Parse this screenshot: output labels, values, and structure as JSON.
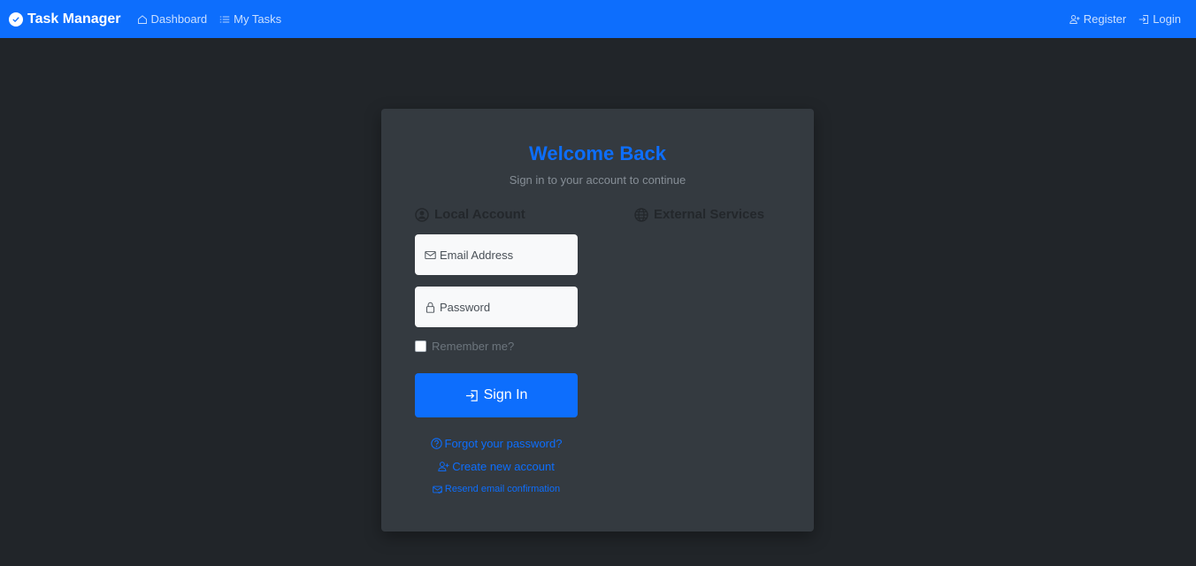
{
  "navbar": {
    "brand": "Task Manager",
    "links": {
      "dashboard": "Dashboard",
      "my_tasks": "My Tasks"
    },
    "right": {
      "register": "Register",
      "login": "Login"
    },
    "color": "#0d6efd"
  },
  "card": {
    "title": "Welcome Back",
    "subtitle": "Sign in to your account to continue",
    "local_heading": "Local Account",
    "external_heading": "External Services",
    "email_placeholder": "Email Address",
    "password_placeholder": "Password",
    "remember_label": "Remember me?",
    "signin_label": "Sign In",
    "forgot_label": "Forgot your password?",
    "create_label": "Create new account",
    "resend_label": "Resend email confirmation"
  },
  "icons": {
    "brand": "check-circle-icon",
    "dashboard": "house-icon",
    "tasks": "list-icon",
    "register": "person-plus-icon",
    "login": "box-arrow-in-right-icon",
    "local": "person-circle-icon",
    "external": "globe-icon",
    "email": "envelope-icon",
    "password": "lock-icon",
    "forgot": "question-circle-icon",
    "resend": "envelope-check-icon"
  },
  "colors": {
    "background": "#212529",
    "card": "#343a40",
    "accent": "#0d6efd"
  }
}
